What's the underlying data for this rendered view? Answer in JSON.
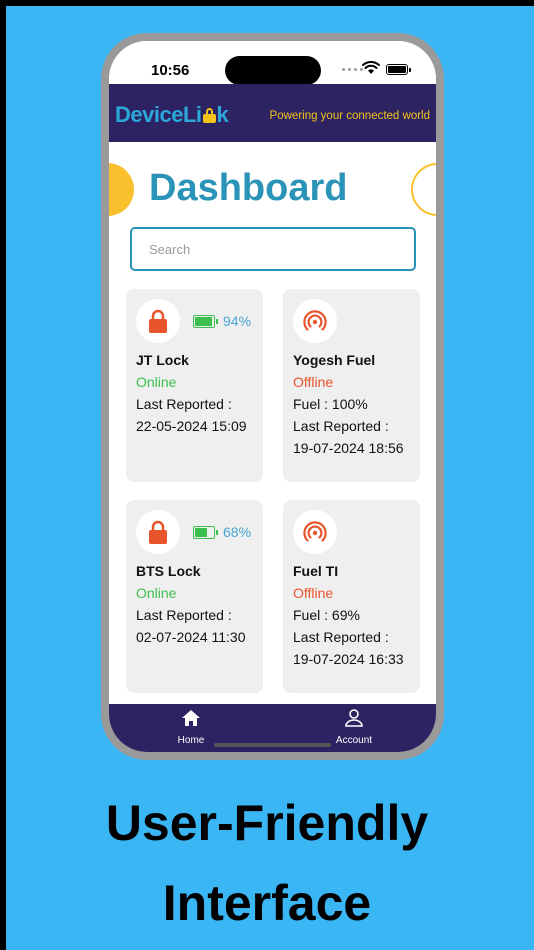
{
  "status_bar": {
    "time": "10:56"
  },
  "header": {
    "logo_part1": "DeviceLi",
    "logo_part2": "k",
    "tagline": "Powering your connected world"
  },
  "dashboard": {
    "title": "Dashboard",
    "search_placeholder": "Search"
  },
  "devices": [
    {
      "name": "JT Lock",
      "status": "Online",
      "battery": "94%",
      "battery_level": 0.94,
      "line1": "Last Reported :",
      "line2": "22-05-2024 15:09",
      "icon": "lock-icon"
    },
    {
      "name": "Yogesh Fuel",
      "status": "Offline",
      "line1": "Fuel : 100%",
      "line2": "Last Reported :",
      "line3": "19-07-2024 18:56",
      "icon": "signal-icon"
    },
    {
      "name": "BTS Lock",
      "status": "Online",
      "battery": "68%",
      "battery_level": 0.68,
      "line1": "Last Reported :",
      "line2": "02-07-2024 11:30",
      "icon": "lock-icon"
    },
    {
      "name": "Fuel TI",
      "status": "Offline",
      "line1": "Fuel : 69%",
      "line2": "Last Reported :",
      "line3": "19-07-2024 16:33",
      "icon": "signal-icon"
    }
  ],
  "nav": {
    "home": "Home",
    "account": "Account"
  },
  "caption": {
    "line1": "User-Friendly",
    "line2": "Interface"
  },
  "colors": {
    "background": "#3bb6f5",
    "header": "#2d2262",
    "accent": "#2a93b8",
    "online": "#3cbf4f",
    "offline": "#e8542c",
    "lock": "#e8542c"
  }
}
